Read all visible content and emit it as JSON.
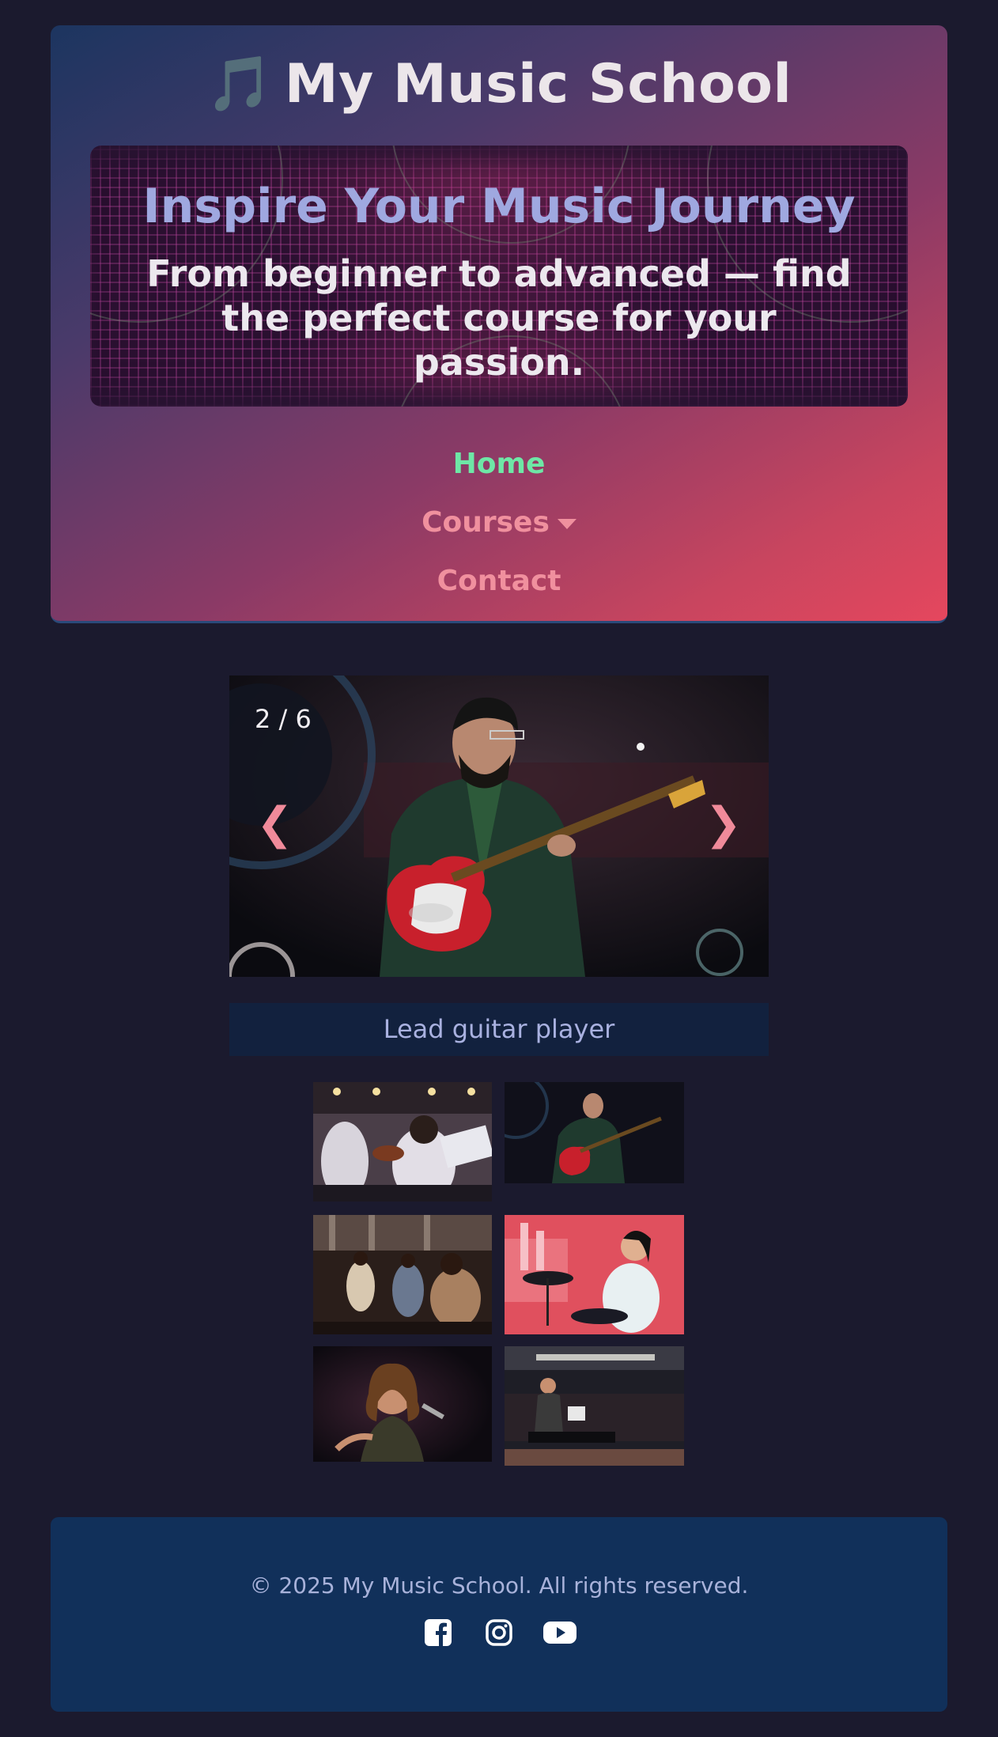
{
  "header": {
    "title": "My Music School",
    "title_icon": "music-note-icon",
    "hero_title": "Inspire Your Music Journey",
    "hero_subtitle": "From beginner to advanced — find the perfect course for your passion.",
    "nav": [
      {
        "label": "Home",
        "active": true
      },
      {
        "label": "Courses",
        "has_dropdown": true
      },
      {
        "label": "Contact"
      }
    ]
  },
  "slider": {
    "counter": "2 / 6",
    "prev_label": "❮",
    "next_label": "❯",
    "caption": "Lead guitar player"
  },
  "thumbnails": [
    {
      "subject": "orchestra"
    },
    {
      "subject": "guitarist"
    },
    {
      "subject": "dancers"
    },
    {
      "subject": "drummer"
    },
    {
      "subject": "singer"
    },
    {
      "subject": "pianist"
    }
  ],
  "footer": {
    "copyright": "© 2025 My Music School. All rights reserved.",
    "social": [
      "facebook-icon",
      "instagram-icon",
      "youtube-icon"
    ]
  },
  "colors": {
    "background": "#1b1a2e",
    "nav_active": "#6ee7a6",
    "nav_link": "#f0909e",
    "caption_bg": "#12213e",
    "footer_bg": "#11305a"
  }
}
